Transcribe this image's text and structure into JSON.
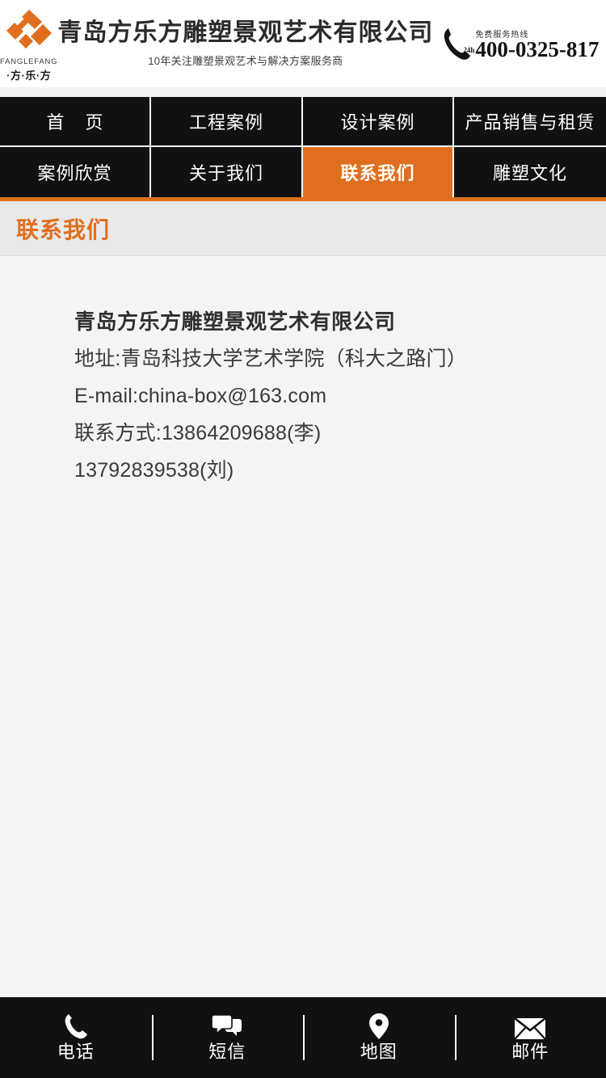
{
  "header": {
    "logo": {
      "mark": "diamond-logo-icon",
      "latin": "FANGLEFANG",
      "chinese": "·方·乐·方"
    },
    "company_name": "青岛方乐方雕塑景观艺术有限公司",
    "tagline": "10年关注雕塑景观艺术与解决方案服务商",
    "phone": {
      "icon": "phone-handset-icon",
      "badge": "24h",
      "label": "免费服务热线",
      "number": "400-0325-817"
    }
  },
  "nav": {
    "items": [
      {
        "label": "首页",
        "active": false
      },
      {
        "label": "工程案例",
        "active": false
      },
      {
        "label": "设计案例",
        "active": false
      },
      {
        "label": "产品销售与租赁",
        "active": false
      },
      {
        "label": "案例欣赏",
        "active": false
      },
      {
        "label": "关于我们",
        "active": false
      },
      {
        "label": "联系我们",
        "active": true
      },
      {
        "label": "雕塑文化",
        "active": false
      }
    ]
  },
  "page": {
    "title": "联系我们"
  },
  "contact": {
    "company": "青岛方乐方雕塑景观艺术有限公司",
    "address": "地址:青岛科技大学艺术学院（科大之路门）",
    "email": "E-mail:china-box@163.com",
    "phone1": "联系方式:13864209688(李)",
    "phone2": "13792839538(刘)"
  },
  "footer": {
    "items": [
      {
        "label": "电话",
        "icon": "phone-icon"
      },
      {
        "label": "短信",
        "icon": "chat-bubbles-icon"
      },
      {
        "label": "地图",
        "icon": "map-pin-icon"
      },
      {
        "label": "邮件",
        "icon": "envelope-icon"
      }
    ]
  },
  "colors": {
    "accent": "#df6f1f",
    "nav_bg": "#111111",
    "page_bg": "#f4f4f4",
    "title_bar_bg": "#e9e9e9"
  }
}
